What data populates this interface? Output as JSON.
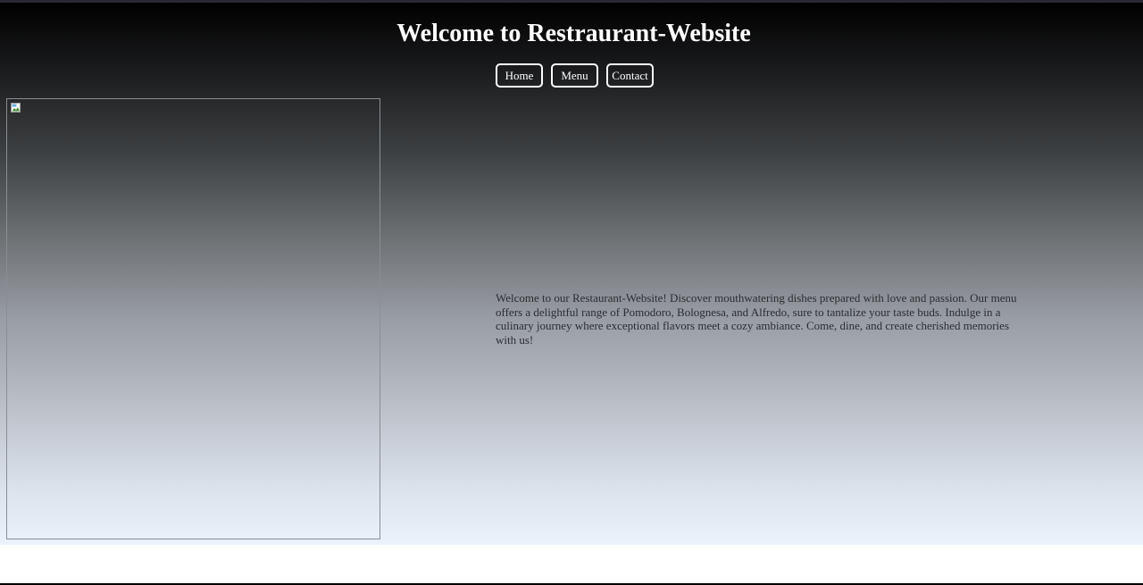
{
  "header": {
    "title": "Welcome to Restraurant-Website"
  },
  "nav": {
    "items": [
      {
        "label": "Home"
      },
      {
        "label": "Menu"
      },
      {
        "label": "Contact"
      }
    ]
  },
  "hero_image": {
    "state": "broken-image",
    "icon": "broken-image-icon"
  },
  "intro": {
    "text": "Welcome to our Restaurant-Website! Discover mouthwatering dishes prepared with love and passion. Our menu offers a delightful range of Pomodoro, Bolognesa, and Alfredo, sure to tantalize your taste buds. Indulge in a culinary journey where exceptional flavors meet a cozy ambiance. Come, dine, and create cherished memories with us!"
  },
  "colors": {
    "gradient_top": "#000000",
    "gradient_bottom": "#eaf2fc",
    "title_color": "#ffffff",
    "body_text": "#2b2d31"
  }
}
